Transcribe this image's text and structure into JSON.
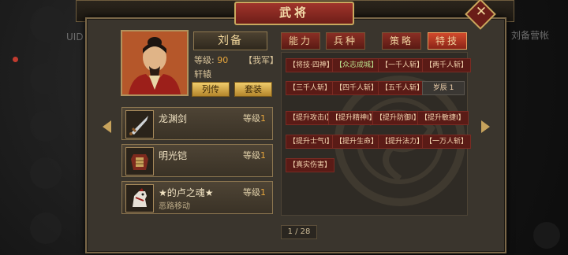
{
  "window": {
    "title": "武将"
  },
  "background": {
    "right_label": "刘备营帐",
    "left_label": "UID"
  },
  "hero": {
    "name": "刘备",
    "level_label": "等级:",
    "level_value": "90",
    "faction": "【我军】",
    "title": "轩辕",
    "bio_button": "列传",
    "outfit_button": "套装"
  },
  "tabs": [
    {
      "label": "能力",
      "active": false
    },
    {
      "label": "兵种",
      "active": false
    },
    {
      "label": "策略",
      "active": false
    },
    {
      "label": "特技",
      "active": true
    }
  ],
  "equipment": [
    {
      "name": "龙渊剑",
      "level_label": "等级",
      "level": "1",
      "effect": "",
      "icon": "sword-icon"
    },
    {
      "name": "明光铠",
      "level_label": "等级",
      "level": "1",
      "effect": "",
      "icon": "armor-icon"
    },
    {
      "name": "★的卢之魂★",
      "level_label": "等级",
      "level": "1",
      "effect": "恶路移动",
      "icon": "horse-icon"
    }
  ],
  "skills": [
    {
      "label": "【将技·四神】"
    },
    {
      "label": "【众志成城】"
    },
    {
      "label": "【一千人斩】"
    },
    {
      "label": "【两千人斩】"
    },
    {
      "label": "【三千人斩】"
    },
    {
      "label": "【四千人斩】"
    },
    {
      "label": "【五千人斩】"
    },
    {
      "label": "岁辰 1"
    },
    {
      "label": "【提升攻击Ⅰ】"
    },
    {
      "label": "【提升精神Ⅰ】"
    },
    {
      "label": "【提升防御Ⅰ】"
    },
    {
      "label": "【提升敏捷Ⅰ】"
    },
    {
      "label": "【提升士气Ⅰ】"
    },
    {
      "label": "【提升生命】"
    },
    {
      "label": "【提升法力】"
    },
    {
      "label": "【一万人斩】"
    },
    {
      "label": "【真实伤害】"
    }
  ],
  "pagination": {
    "text": "1 / 28"
  },
  "colors": {
    "accent_gold": "#c9a85e",
    "tab_red": "#8a2f24",
    "level_orange": "#e7a63d"
  }
}
